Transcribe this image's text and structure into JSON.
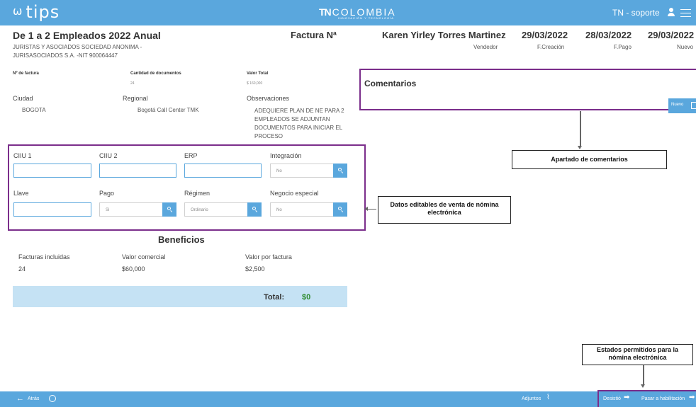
{
  "header": {
    "logo": "tips",
    "brand": "COLOMBIA",
    "brand_prefix": "TN",
    "brand_subtitle": "INNOVACIÓN Y TECNOLOGÍA",
    "user": "TN - soporte"
  },
  "invoice": {
    "plan_title": "De 1 a 2 Empleados 2022 Anual",
    "company_line1": "JURISTAS Y ASOCIADOS SOCIEDAD ANONIMA -",
    "company_line2": "JURISASOCIADOS S.A. -NIT 900064447",
    "factura_label": "Factura Nª",
    "vendor_name": "Karen Yirley Torres Martinez",
    "vendor_label": "Vendedor",
    "creation_date": "29/03/2022",
    "creation_label": "F.Creación",
    "payment_date": "28/03/2022",
    "payment_label": "F.Pago",
    "new_date": "29/03/2022",
    "new_label": "Nuevo"
  },
  "summary": {
    "num_factura_label": "Nº de factura",
    "cantidad_label": "Cantidad de documentos",
    "cantidad_value": "24",
    "valor_total_label": "Valor Total",
    "valor_total_value": "$ 160,000",
    "ciudad_label": "Ciudad",
    "ciudad_value": "BOGOTA",
    "regional_label": "Regional",
    "regional_value": "Bogotá Call Center TMK",
    "observaciones_label": "Observaciones",
    "observaciones_lines": [
      "ADEQUIERE PLAN DE NE PARA 2",
      "EMPLEADOS SE ADJUNTAN",
      "DOCUMENTOS PARA INICIAR EL",
      "PROCESO"
    ]
  },
  "form": {
    "ciiu1_label": "CIIU 1",
    "ciiu2_label": "CIIU 2",
    "erp_label": "ERP",
    "integracion_label": "Integración",
    "integracion_value": "No",
    "llave_label": "Llave",
    "pago_label": "Pago",
    "pago_value": "Si",
    "regimen_label": "Régimen",
    "regimen_value": "Ordinario",
    "negocio_label": "Negocio especial",
    "negocio_value": "No"
  },
  "beneficios": {
    "title": "Beneficios",
    "facturas_label": "Facturas incluidas",
    "facturas_value": "24",
    "valor_comercial_label": "Valor comercial",
    "valor_comercial_value": "$60,000",
    "valor_factura_label": "Valor por factura",
    "valor_factura_value": "$2,500",
    "total_label": "Total:",
    "total_value": "$0"
  },
  "comments": {
    "title": "Comentarios",
    "new_button": "Nuevo"
  },
  "annotations": {
    "comments": "Apartado de comentarios",
    "editable_line1": "Datos editables de venta de nómina",
    "editable_line2": "electrónica",
    "states_line1": "Estados permitidos para la",
    "states_line2": "nómina electrónica"
  },
  "footer": {
    "back": "Atrás",
    "attachments": "Adjuntos",
    "desistio": "Desistió",
    "habilitacion": "Pasar a habilitación"
  },
  "colors": {
    "accent": "#5aa7dd",
    "highlight_box": "#7b2e8b",
    "total_bar": "#c5e2f4",
    "total_value": "#2e8b2e"
  }
}
